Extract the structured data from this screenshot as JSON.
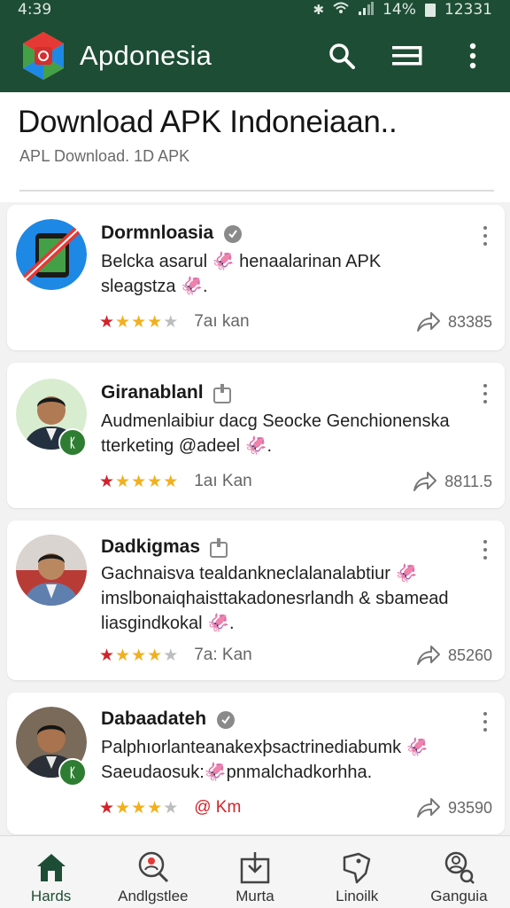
{
  "status_bar": {
    "time": "4:39",
    "battery": "14%",
    "clock": "12331"
  },
  "app_bar": {
    "title": "Apdonesia"
  },
  "header": {
    "title": "Download APK Indoneiaan..",
    "subtitle": "APᒪ Download. 1D APK"
  },
  "apps": [
    {
      "name": "Dormnloasia",
      "desc_line1": "Belcka asarul 🦑 henaalarinan APK",
      "desc_line2": "sleagstza 🦑.",
      "desc_line3": "",
      "rating": 4,
      "meta": "7aı kan",
      "meta_red": false,
      "shares": "83385"
    },
    {
      "name": "Giranablanl",
      "desc_line1": "Audmenlaibiur dacg Seocke Genchionenska",
      "desc_line2": "tterketing @adeel 🦑.",
      "desc_line3": "",
      "rating": 5,
      "meta": "1aı Kan",
      "meta_red": false,
      "shares": "8811.5"
    },
    {
      "name": "Dadkigmas",
      "desc_line1": "Gachnaisva tealdankneclalanalabtiur 🦑",
      "desc_line2": "imslbonaiqhaisttakadonesrlandh & sbamead",
      "desc_line3": "liasgindkokal 🦑.",
      "rating": 4,
      "meta": "7a: Kan",
      "meta_red": false,
      "shares": "85260"
    },
    {
      "name": "Dabaadateh",
      "desc_line1": "Palphıorlanteanakexþsactrinediabumk 🦑",
      "desc_line2": "Saeudaosuk:🦑pnmalchadkorhha.",
      "desc_line3": "",
      "rating": 4,
      "meta": "@ Km",
      "meta_red": true,
      "shares": "93590"
    }
  ],
  "bottom_nav": [
    {
      "label": "Hards",
      "icon": "home-icon"
    },
    {
      "label": "Andlgstlee",
      "icon": "search-person-icon"
    },
    {
      "label": "Murta",
      "icon": "download-box-icon"
    },
    {
      "label": "Linoilk",
      "icon": "tag-icon"
    },
    {
      "label": "Ganguia",
      "icon": "user-search-icon"
    }
  ],
  "colors": {
    "primary": "#1e4d35",
    "star": "#f2b01e",
    "star_red": "#d2232a",
    "star_empty": "#bdbdbd"
  }
}
